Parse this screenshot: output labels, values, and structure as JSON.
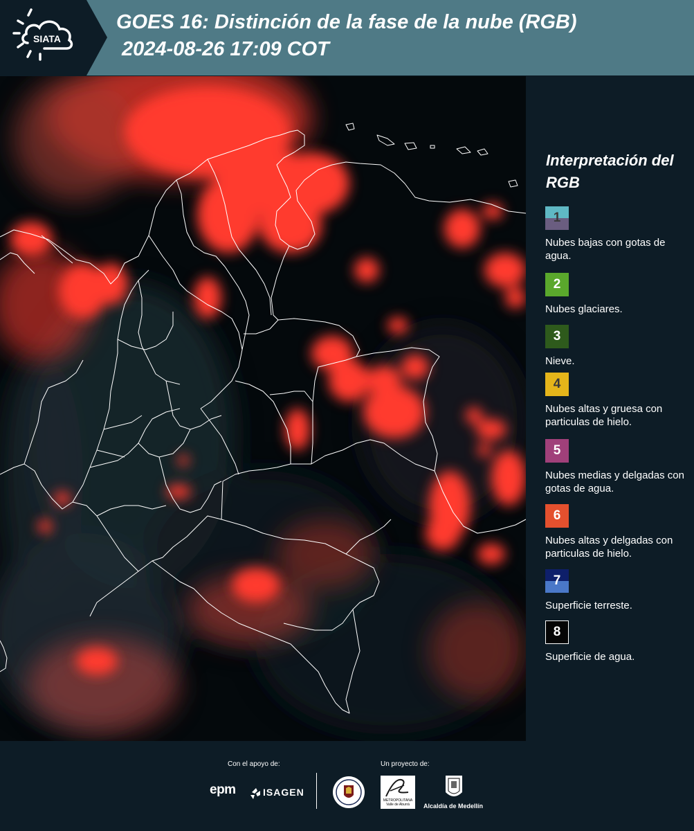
{
  "header": {
    "logo_text": "SIATA",
    "title": "GOES 16: Distinción de la fase de la nube (RGB)",
    "subtitle": "2024-08-26 17:09 COT",
    "background_color": "#4f7a86",
    "logo_background_color": "#0d1c26"
  },
  "map": {
    "background_color": "#04090c",
    "cloud_color": "#ff3b2e",
    "boundary_color": "#ffffff"
  },
  "legend": {
    "title": "Interpretación del RGB",
    "items": [
      {
        "number": "1",
        "label": "Nubes bajas con gotas de agua.",
        "color_top": "#5fb8c4",
        "color_bottom": "#6a5d80"
      },
      {
        "number": "2",
        "label": "Nubes glaciares.",
        "color_top": "#5aa82c",
        "color_bottom": "#5aa82c"
      },
      {
        "number": "3",
        "label": "Nieve.",
        "color_top": "#2e5a1c",
        "color_bottom": "#2e5a1c"
      },
      {
        "number": "4",
        "label": "Nubes altas y gruesa con particulas de hielo.",
        "color_top": "#e5b51a",
        "color_bottom": "#e5b51a"
      },
      {
        "number": "5",
        "label": "Nubes medias y delgadas con gotas de agua.",
        "color_top": "#a0407a",
        "color_bottom": "#a0407a"
      },
      {
        "number": "6",
        "label": "Nubes altas y delgadas con particulas de hielo.",
        "color_top": "#e4502e",
        "color_bottom": "#e4502e"
      },
      {
        "number": "7",
        "label": "Superficie terreste.",
        "color_top": "#0e1f6a",
        "color_bottom": "#4a78c8"
      },
      {
        "number": "8",
        "label": "Superficie de agua.",
        "color_top": "#050505",
        "color_bottom": "#050505"
      }
    ]
  },
  "footer": {
    "support_label": "Con el apoyo de:",
    "project_label": "Un proyecto de:",
    "epm_logo_text": "epm",
    "isagen_logo_text": "ISAGEN",
    "area_logo_text": "METROPOLITANA Valle de Aburrá",
    "medellin_label": "Alcaldía de Medellín"
  }
}
